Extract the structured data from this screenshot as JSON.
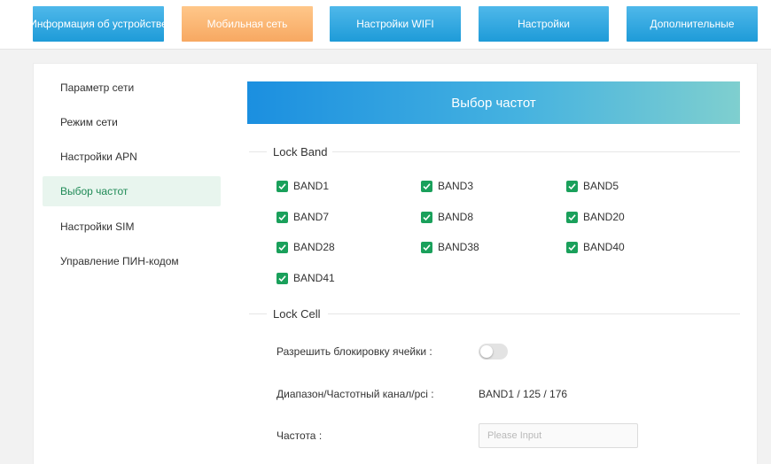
{
  "nav": {
    "tabs": [
      {
        "label": "Информация об устройстве"
      },
      {
        "label": "Мобильная сеть"
      },
      {
        "label": "Настройки WIFI"
      },
      {
        "label": "Настройки"
      },
      {
        "label": "Дополнительные"
      }
    ],
    "active_index": 1
  },
  "sidebar": {
    "items": [
      {
        "label": "Параметр сети"
      },
      {
        "label": "Режим сети"
      },
      {
        "label": "Настройки APN"
      },
      {
        "label": "Выбор частот"
      },
      {
        "label": "Настройки SIM"
      },
      {
        "label": "Управление ПИН-кодом"
      }
    ],
    "active_index": 3
  },
  "page": {
    "title": "Выбор частот"
  },
  "lock_band": {
    "title": "Lock Band",
    "bands": [
      {
        "label": "BAND1",
        "checked": true
      },
      {
        "label": "BAND3",
        "checked": true
      },
      {
        "label": "BAND5",
        "checked": true
      },
      {
        "label": "BAND7",
        "checked": true
      },
      {
        "label": "BAND8",
        "checked": true
      },
      {
        "label": "BAND20",
        "checked": true
      },
      {
        "label": "BAND28",
        "checked": true
      },
      {
        "label": "BAND38",
        "checked": true
      },
      {
        "label": "BAND40",
        "checked": true
      },
      {
        "label": "BAND41",
        "checked": true
      }
    ]
  },
  "lock_cell": {
    "title": "Lock Cell",
    "enable_label": "Разрешить блокировку ячейки :",
    "enable_on": false,
    "range_label": "Диапазон/Частотный канал/pci :",
    "range_value": "BAND1 / 125 / 176",
    "freq_label": "Частота :",
    "freq_placeholder": "Please Input",
    "freq_value": ""
  },
  "colors": {
    "accent_green": "#1aa05b",
    "active_tab": "#f7a862",
    "tab_blue": "#1e9bd8"
  }
}
